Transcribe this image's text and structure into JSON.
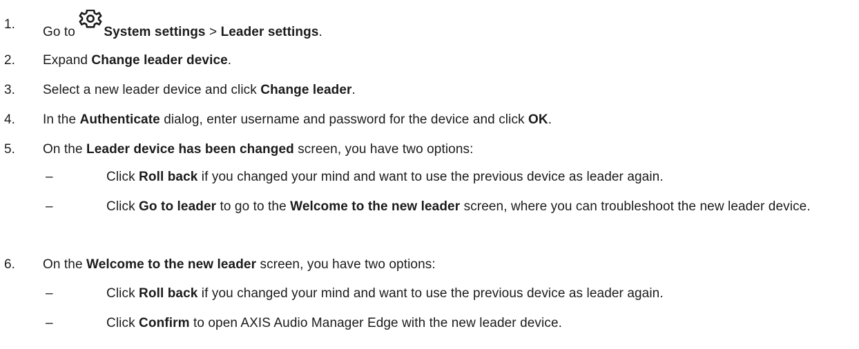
{
  "steps": [
    {
      "num": "1.",
      "parts": [
        {
          "t": "Go to "
        },
        {
          "icon": "gear-icon"
        },
        {
          "t": "System settings",
          "b": true
        },
        {
          "t": " > "
        },
        {
          "t": "Leader settings",
          "b": true
        },
        {
          "t": "."
        }
      ]
    },
    {
      "num": "2.",
      "parts": [
        {
          "t": "Expand "
        },
        {
          "t": "Change leader device",
          "b": true
        },
        {
          "t": "."
        }
      ]
    },
    {
      "num": "3.",
      "parts": [
        {
          "t": "Select a new leader device and click "
        },
        {
          "t": "Change leader",
          "b": true
        },
        {
          "t": "."
        }
      ]
    },
    {
      "num": "4.",
      "parts": [
        {
          "t": "In the "
        },
        {
          "t": "Authenticate",
          "b": true
        },
        {
          "t": " dialog, enter username and password for the device and click "
        },
        {
          "t": "OK",
          "b": true
        },
        {
          "t": "."
        }
      ]
    },
    {
      "num": "5.",
      "parts": [
        {
          "t": "On the "
        },
        {
          "t": "Leader device has been changed",
          "b": true
        },
        {
          "t": " screen, you have two options:"
        }
      ],
      "subs": [
        {
          "dash": "–",
          "parts": [
            {
              "t": "Click "
            },
            {
              "t": "Roll back",
              "b": true
            },
            {
              "t": " if you changed your mind and want to use the previous device as leader again."
            }
          ]
        },
        {
          "dash": "–",
          "parts": [
            {
              "t": "Click "
            },
            {
              "t": "Go to leader",
              "b": true
            },
            {
              "t": " to go to the "
            },
            {
              "t": "Welcome to the new leader",
              "b": true
            },
            {
              "t": " screen, where you can troubleshoot the new leader device."
            }
          ]
        }
      ]
    },
    {
      "num": "6.",
      "parts": [
        {
          "t": "On the "
        },
        {
          "t": "Welcome to the new leader",
          "b": true
        },
        {
          "t": " screen, you have two options:"
        }
      ],
      "subs": [
        {
          "dash": "–",
          "parts": [
            {
              "t": "Click "
            },
            {
              "t": "Roll back",
              "b": true
            },
            {
              "t": " if you changed your mind and want to use the previous device as leader again."
            }
          ]
        },
        {
          "dash": "–",
          "parts": [
            {
              "t": "Click "
            },
            {
              "t": "Confirm",
              "b": true
            },
            {
              "t": " to open AXIS Audio Manager Edge with the new leader device."
            }
          ]
        }
      ]
    }
  ]
}
